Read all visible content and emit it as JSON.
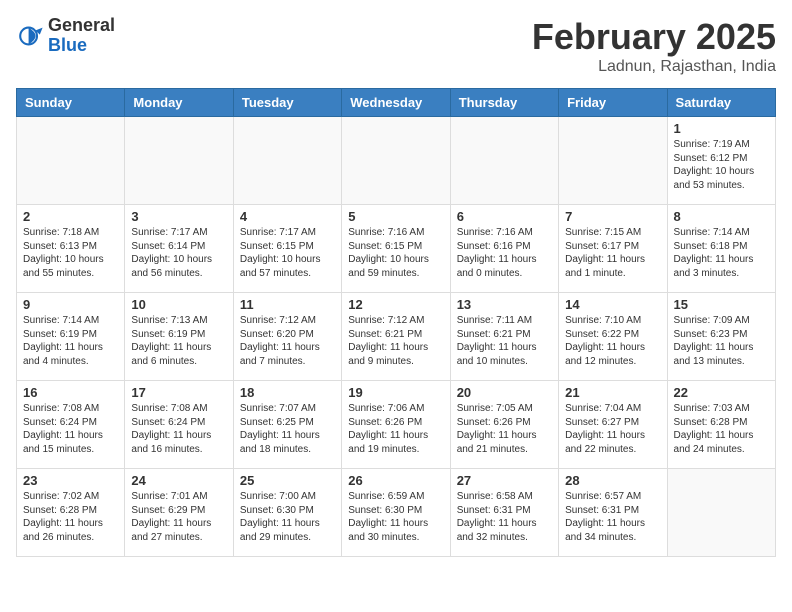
{
  "logo": {
    "general": "General",
    "blue": "Blue"
  },
  "title": "February 2025",
  "location": "Ladnun, Rajasthan, India",
  "days_of_week": [
    "Sunday",
    "Monday",
    "Tuesday",
    "Wednesday",
    "Thursday",
    "Friday",
    "Saturday"
  ],
  "weeks": [
    [
      {
        "day": "",
        "info": ""
      },
      {
        "day": "",
        "info": ""
      },
      {
        "day": "",
        "info": ""
      },
      {
        "day": "",
        "info": ""
      },
      {
        "day": "",
        "info": ""
      },
      {
        "day": "",
        "info": ""
      },
      {
        "day": "1",
        "info": "Sunrise: 7:19 AM\nSunset: 6:12 PM\nDaylight: 10 hours and 53 minutes."
      }
    ],
    [
      {
        "day": "2",
        "info": "Sunrise: 7:18 AM\nSunset: 6:13 PM\nDaylight: 10 hours and 55 minutes."
      },
      {
        "day": "3",
        "info": "Sunrise: 7:17 AM\nSunset: 6:14 PM\nDaylight: 10 hours and 56 minutes."
      },
      {
        "day": "4",
        "info": "Sunrise: 7:17 AM\nSunset: 6:15 PM\nDaylight: 10 hours and 57 minutes."
      },
      {
        "day": "5",
        "info": "Sunrise: 7:16 AM\nSunset: 6:15 PM\nDaylight: 10 hours and 59 minutes."
      },
      {
        "day": "6",
        "info": "Sunrise: 7:16 AM\nSunset: 6:16 PM\nDaylight: 11 hours and 0 minutes."
      },
      {
        "day": "7",
        "info": "Sunrise: 7:15 AM\nSunset: 6:17 PM\nDaylight: 11 hours and 1 minute."
      },
      {
        "day": "8",
        "info": "Sunrise: 7:14 AM\nSunset: 6:18 PM\nDaylight: 11 hours and 3 minutes."
      }
    ],
    [
      {
        "day": "9",
        "info": "Sunrise: 7:14 AM\nSunset: 6:19 PM\nDaylight: 11 hours and 4 minutes."
      },
      {
        "day": "10",
        "info": "Sunrise: 7:13 AM\nSunset: 6:19 PM\nDaylight: 11 hours and 6 minutes."
      },
      {
        "day": "11",
        "info": "Sunrise: 7:12 AM\nSunset: 6:20 PM\nDaylight: 11 hours and 7 minutes."
      },
      {
        "day": "12",
        "info": "Sunrise: 7:12 AM\nSunset: 6:21 PM\nDaylight: 11 hours and 9 minutes."
      },
      {
        "day": "13",
        "info": "Sunrise: 7:11 AM\nSunset: 6:21 PM\nDaylight: 11 hours and 10 minutes."
      },
      {
        "day": "14",
        "info": "Sunrise: 7:10 AM\nSunset: 6:22 PM\nDaylight: 11 hours and 12 minutes."
      },
      {
        "day": "15",
        "info": "Sunrise: 7:09 AM\nSunset: 6:23 PM\nDaylight: 11 hours and 13 minutes."
      }
    ],
    [
      {
        "day": "16",
        "info": "Sunrise: 7:08 AM\nSunset: 6:24 PM\nDaylight: 11 hours and 15 minutes."
      },
      {
        "day": "17",
        "info": "Sunrise: 7:08 AM\nSunset: 6:24 PM\nDaylight: 11 hours and 16 minutes."
      },
      {
        "day": "18",
        "info": "Sunrise: 7:07 AM\nSunset: 6:25 PM\nDaylight: 11 hours and 18 minutes."
      },
      {
        "day": "19",
        "info": "Sunrise: 7:06 AM\nSunset: 6:26 PM\nDaylight: 11 hours and 19 minutes."
      },
      {
        "day": "20",
        "info": "Sunrise: 7:05 AM\nSunset: 6:26 PM\nDaylight: 11 hours and 21 minutes."
      },
      {
        "day": "21",
        "info": "Sunrise: 7:04 AM\nSunset: 6:27 PM\nDaylight: 11 hours and 22 minutes."
      },
      {
        "day": "22",
        "info": "Sunrise: 7:03 AM\nSunset: 6:28 PM\nDaylight: 11 hours and 24 minutes."
      }
    ],
    [
      {
        "day": "23",
        "info": "Sunrise: 7:02 AM\nSunset: 6:28 PM\nDaylight: 11 hours and 26 minutes."
      },
      {
        "day": "24",
        "info": "Sunrise: 7:01 AM\nSunset: 6:29 PM\nDaylight: 11 hours and 27 minutes."
      },
      {
        "day": "25",
        "info": "Sunrise: 7:00 AM\nSunset: 6:30 PM\nDaylight: 11 hours and 29 minutes."
      },
      {
        "day": "26",
        "info": "Sunrise: 6:59 AM\nSunset: 6:30 PM\nDaylight: 11 hours and 30 minutes."
      },
      {
        "day": "27",
        "info": "Sunrise: 6:58 AM\nSunset: 6:31 PM\nDaylight: 11 hours and 32 minutes."
      },
      {
        "day": "28",
        "info": "Sunrise: 6:57 AM\nSunset: 6:31 PM\nDaylight: 11 hours and 34 minutes."
      },
      {
        "day": "",
        "info": ""
      }
    ]
  ]
}
